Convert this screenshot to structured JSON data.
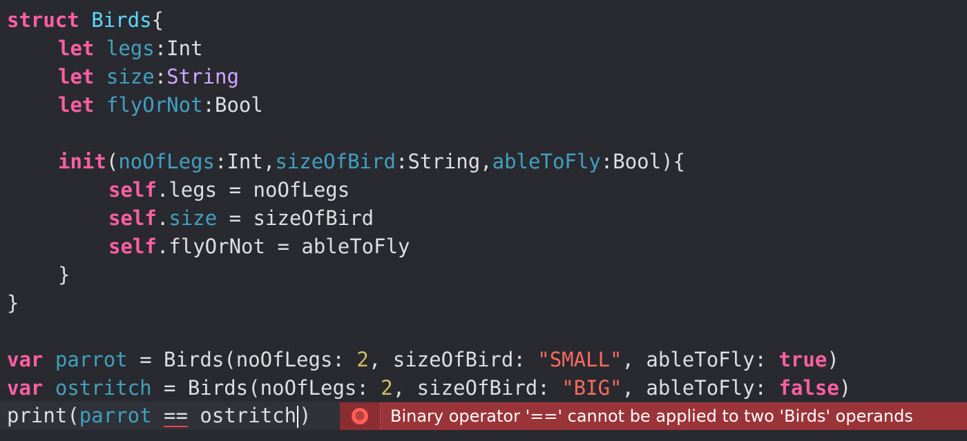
{
  "code": {
    "l1": {
      "kw": "struct",
      "name": "Birds",
      "brace": "{"
    },
    "l2": {
      "kw": "let",
      "prop": "legs",
      "colon": ":",
      "type": "Int"
    },
    "l3": {
      "kw": "let",
      "prop": "size",
      "colon": ":",
      "type": "String"
    },
    "l4": {
      "kw": "let",
      "prop": "flyOrNot",
      "colon": ":",
      "type": "Bool"
    },
    "l6": {
      "kw": "init",
      "open": "(",
      "p1": "noOfLegs",
      "c1": ":",
      "t1": "Int",
      "comma1": ",",
      "p2": "sizeOfBird",
      "c2": ":",
      "t2": "String",
      "comma2": ",",
      "p3": "ableToFly",
      "c3": ":",
      "t3": "Bool",
      "close": "){"
    },
    "l7": {
      "self": "self",
      "rest": ".legs = noOfLegs"
    },
    "l8": {
      "self": "self",
      "dot": ".",
      "prop": "size",
      "rest": " = sizeOfBird"
    },
    "l9": {
      "self": "self",
      "rest": ".flyOrNot = ableToFly"
    },
    "l10": {
      "brace": "}"
    },
    "l11": {
      "brace": "}"
    },
    "l13": {
      "kw": "var",
      "name": "parrot",
      "eq": " = Birds(noOfLegs: ",
      "n": "2",
      "mid": ", sizeOfBird: ",
      "s": "\"SMALL\"",
      "mid2": ", ableToFly: ",
      "b": "true",
      "end": ")"
    },
    "l14": {
      "kw": "var",
      "name": "ostritch",
      "eq": " = Birds(noOfLegs: ",
      "n": "2",
      "mid": ", sizeOfBird: ",
      "s": "\"BIG\"",
      "mid2": ", ableToFly: ",
      "b": "false",
      "end": ")"
    },
    "l15": {
      "fn": "print",
      "open": "(",
      "a": "parrot",
      "op": "==",
      "b": "ostritch",
      "close": ")"
    }
  },
  "error": {
    "icon": "error-x-circle-icon",
    "glyph": "⊗",
    "message": "Binary operator '==' cannot be applied to two 'Birds' operands"
  },
  "colors": {
    "background": "#292a30",
    "keyword": "#fc5fa3",
    "type": "#5dd8ff",
    "property": "#41a1c0",
    "builtin_type": "#d0a8ff",
    "number": "#d0bf69",
    "string": "#fc6a5d",
    "error_banner": "#9b3438"
  }
}
